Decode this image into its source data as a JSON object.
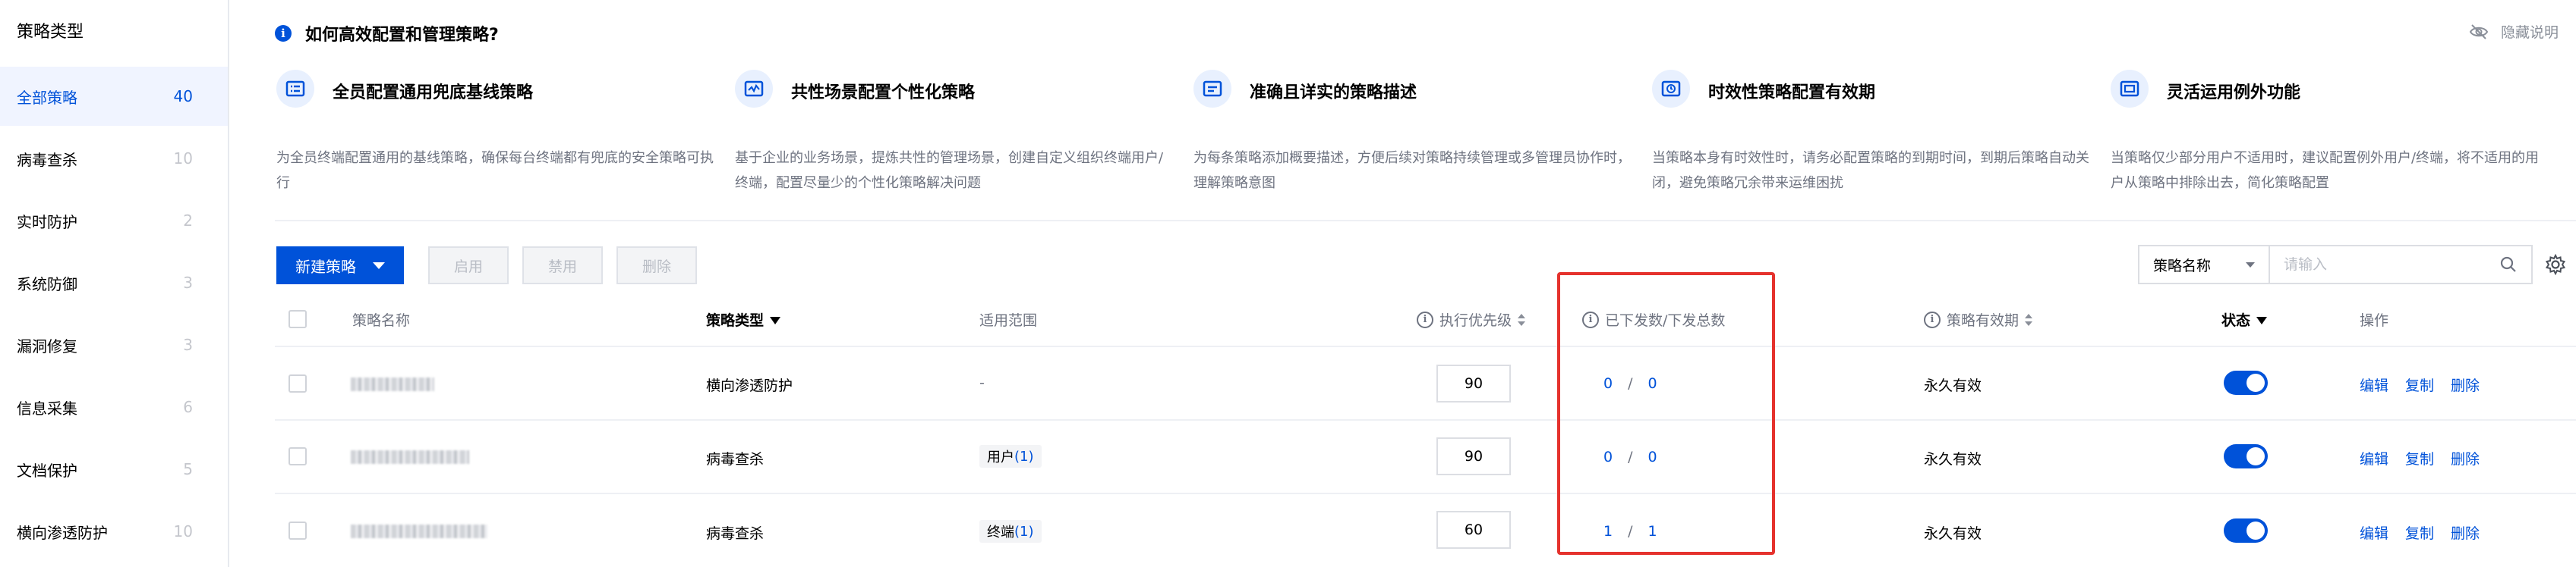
{
  "sidebar": {
    "heading": "策略类型",
    "items": [
      {
        "label": "全部策略",
        "count": "40"
      },
      {
        "label": "病毒查杀",
        "count": "10"
      },
      {
        "label": "实时防护",
        "count": "2"
      },
      {
        "label": "系统防御",
        "count": "3"
      },
      {
        "label": "漏洞修复",
        "count": "3"
      },
      {
        "label": "信息采集",
        "count": "6"
      },
      {
        "label": "文档保护",
        "count": "5"
      },
      {
        "label": "横向渗透防护",
        "count": "10"
      }
    ],
    "active_index": 0
  },
  "help": {
    "title": "如何高效配置和管理策略?",
    "hide_label": "隐藏说明",
    "tips": [
      {
        "icon": "doc-list-icon",
        "title": "全员配置通用兜底基线策略",
        "desc": "为全员终端配置通用的基线策略，确保每台终端都有兜底的安全策略可执行"
      },
      {
        "icon": "chart-pulse-icon",
        "title": "共性场景配置个性化策略",
        "desc": "基于企业的业务场景，提炼共性的管理场景，创建自定义组织终端用户/终端，配置尽量少的个性化策略解决问题"
      },
      {
        "icon": "doc-text-icon",
        "title": "准确且详实的策略描述",
        "desc": "为每条策略添加概要描述，方便后续对策略持续管理或多管理员协作时，理解策略意图"
      },
      {
        "icon": "clock-icon",
        "title": "时效性策略配置有效期",
        "desc": "当策略本身有时效性时，请务必配置策略的到期时间，到期后策略自动关闭，避免策略冗余带来运维困扰"
      },
      {
        "icon": "doc-exception-icon",
        "title": "灵活运用例外功能",
        "desc": "当策略仅少部分用户不适用时，建议配置例外用户/终端，将不适用的用户从策略中排除出去，简化策略配置"
      }
    ]
  },
  "toolbar": {
    "new_label": "新建策略",
    "enable_label": "启用",
    "disable_label": "禁用",
    "delete_label": "删除",
    "filter_field": "策略名称",
    "search_placeholder": "请输入"
  },
  "table": {
    "headers": {
      "name": "策略名称",
      "type": "策略类型",
      "scope": "适用范围",
      "priority": "执行优先级",
      "sent": "已下发数/下发总数",
      "validity": "策略有效期",
      "status": "状态",
      "ops": "操作"
    },
    "rows": [
      {
        "type": "横向渗透防护",
        "scope_label": "-",
        "scope_count": "",
        "priority": "90",
        "sent": "0",
        "total": "0",
        "validity": "永久有效",
        "enabled": true
      },
      {
        "type": "病毒查杀",
        "scope_label": "用户",
        "scope_count": "(1)",
        "priority": "90",
        "sent": "0",
        "total": "0",
        "validity": "永久有效",
        "enabled": true
      },
      {
        "type": "病毒查杀",
        "scope_label": "终端",
        "scope_count": "(1)",
        "priority": "60",
        "sent": "1",
        "total": "1",
        "validity": "永久有效",
        "enabled": true
      }
    ],
    "sent_separator": "/",
    "ops": {
      "edit": "编辑",
      "copy": "复制",
      "delete": "删除"
    }
  },
  "colors": {
    "brand": "#0052d9",
    "highlight": "#e5322d",
    "active_bg": "#f0f4ff"
  }
}
